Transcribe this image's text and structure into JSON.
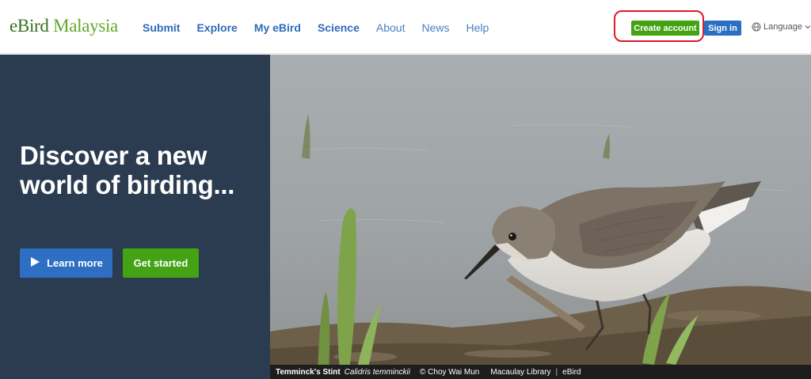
{
  "brand": {
    "name_part1": "eBird",
    "name_part2": "Malaysia"
  },
  "nav": {
    "items": [
      {
        "label": "Submit"
      },
      {
        "label": "Explore"
      },
      {
        "label": "My eBird"
      },
      {
        "label": "Science"
      },
      {
        "label": "About"
      },
      {
        "label": "News"
      },
      {
        "label": "Help"
      }
    ]
  },
  "account": {
    "create_label": "Create account",
    "signin_label": "Sign in",
    "language_label": "Language"
  },
  "hero": {
    "title": "Discover a new world of birding...",
    "learn_more_label": "Learn more",
    "get_started_label": "Get started"
  },
  "photo_caption": {
    "species": "Temminck's Stint",
    "scientific": "Calidris temminckii",
    "credit": "© Choy Wai Mun",
    "library": "Macaulay Library",
    "separator": "|",
    "source": "eBird"
  },
  "colors": {
    "primary_blue": "#2e6fc4",
    "accent_green": "#44a314",
    "hero_panel": "#2b3b50",
    "highlight_ring": "#e0182a"
  }
}
